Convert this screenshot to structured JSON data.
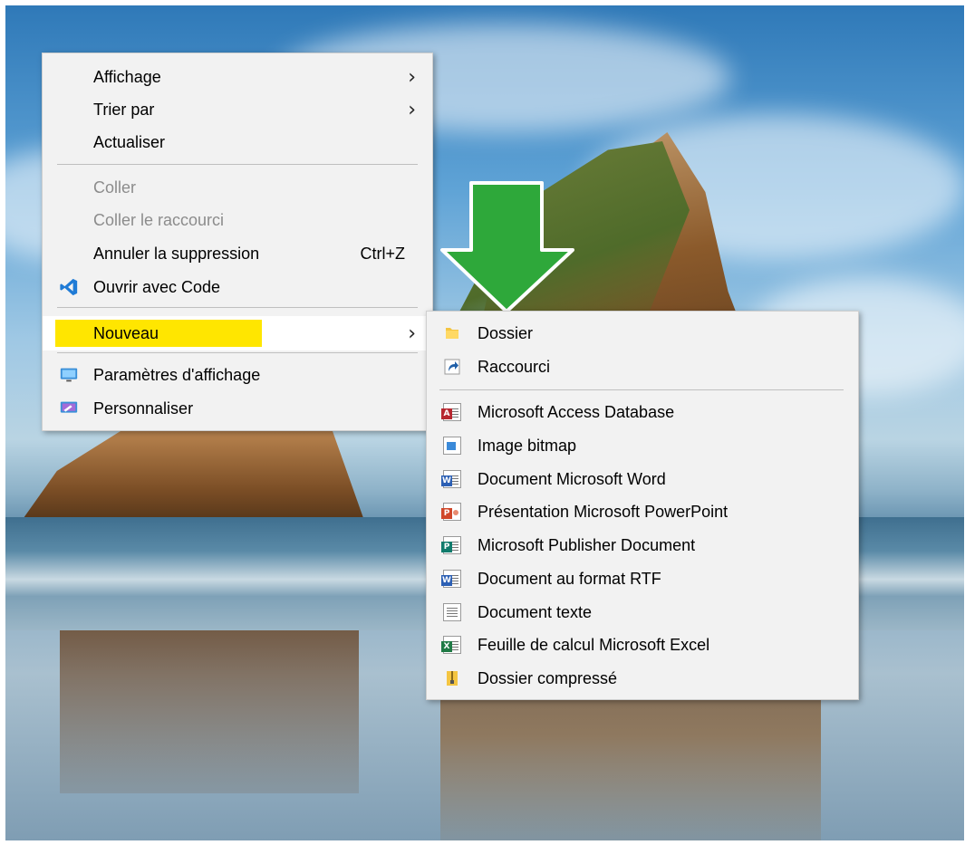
{
  "context_menu": {
    "items": [
      {
        "label": "Affichage",
        "has_submenu": true
      },
      {
        "label": "Trier par",
        "has_submenu": true
      },
      {
        "label": "Actualiser"
      },
      {
        "label": "Coller",
        "disabled": true
      },
      {
        "label": "Coller le raccourci",
        "disabled": true
      },
      {
        "label": "Annuler la suppression",
        "shortcut": "Ctrl+Z"
      },
      {
        "label": "Ouvrir avec Code",
        "icon": "vscode-icon"
      },
      {
        "label": "Nouveau",
        "has_submenu": true,
        "highlighted": true
      },
      {
        "label": "Paramètres d'affichage",
        "icon": "display-settings-icon"
      },
      {
        "label": "Personnaliser",
        "icon": "personalize-icon"
      }
    ]
  },
  "submenu": {
    "items": [
      {
        "label": "Dossier",
        "icon": "folder-icon"
      },
      {
        "label": "Raccourci",
        "icon": "shortcut-icon"
      },
      {
        "label": "Microsoft Access Database",
        "icon": "access-file-icon"
      },
      {
        "label": "Image bitmap",
        "icon": "bitmap-file-icon"
      },
      {
        "label": "Document Microsoft Word",
        "icon": "word-file-icon"
      },
      {
        "label": "Présentation Microsoft PowerPoint",
        "icon": "powerpoint-file-icon"
      },
      {
        "label": "Microsoft Publisher Document",
        "icon": "publisher-file-icon"
      },
      {
        "label": "Document au format RTF",
        "icon": "rtf-file-icon"
      },
      {
        "label": "Document texte",
        "icon": "text-file-icon"
      },
      {
        "label": "Feuille de calcul Microsoft Excel",
        "icon": "excel-file-icon"
      },
      {
        "label": "Dossier compressé",
        "icon": "zip-folder-icon"
      }
    ]
  },
  "colors": {
    "highlight": "#ffe600",
    "arrow": "#2ea83a",
    "menu_bg": "#f2f2f2"
  }
}
